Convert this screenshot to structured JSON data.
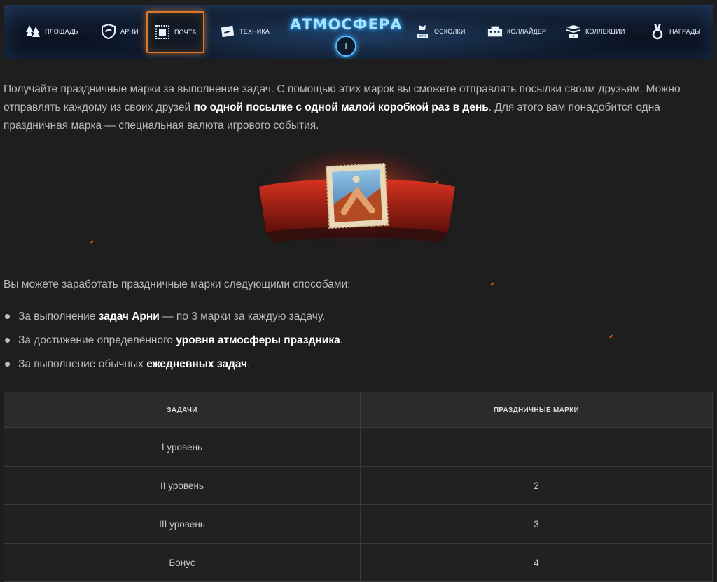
{
  "nav": {
    "items": [
      {
        "label": "Площадь",
        "icon": "trees-icon"
      },
      {
        "label": "Арни",
        "icon": "shield-icon"
      },
      {
        "label": "Почта",
        "icon": "stamp-icon",
        "active": true
      },
      {
        "label": "Техника",
        "icon": "tank-card-icon"
      },
      {
        "label": "Осколки",
        "icon": "shards-icon",
        "badge": "500"
      },
      {
        "label": "Коллайдер",
        "icon": "collider-icon"
      },
      {
        "label": "Коллекции",
        "icon": "collection-icon",
        "badge": "1"
      },
      {
        "label": "Награды",
        "icon": "medal-icon"
      }
    ],
    "logo": {
      "title": "АТМОСФЕРА",
      "level": "I"
    },
    "accent_color": "#d97a2a"
  },
  "intro": {
    "part1": "Получайте праздничные марки за выполнение задач. С помощью этих марок вы сможете отправлять посылки своим друзьям. Можно отправлять каждому из своих друзей ",
    "bold": "по одной посылке с одной малой коробкой раз в день",
    "part2": ". Для этого вам понадобится одна праздничная марка — специальная валюта игрового события."
  },
  "ways": {
    "title": "Вы можете заработать праздничные марки следующими способами:",
    "items": [
      {
        "before": "За выполнение ",
        "bold": "задач Арни",
        "after": " — по 3 марки за каждую задачу."
      },
      {
        "before": "За достижение определённого ",
        "bold": "уровня атмосферы праздника",
        "after": "."
      },
      {
        "before": "За выполнение обычных ",
        "bold": "ежедневных задач",
        "after": "."
      }
    ]
  },
  "table": {
    "headers": [
      "Задачи",
      "Праздничные марки"
    ],
    "rows": [
      [
        "I уровень",
        "—"
      ],
      [
        "II уровень",
        "2"
      ],
      [
        "III уровень",
        "3"
      ],
      [
        "Бонус",
        "4"
      ]
    ]
  }
}
